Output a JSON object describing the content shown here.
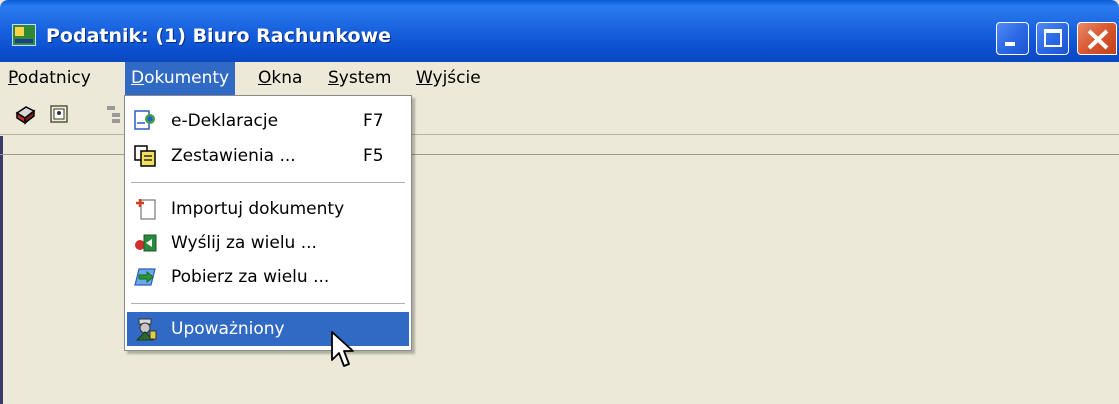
{
  "window": {
    "title": "Podatnik: (1) Biuro Rachunkowe",
    "icon": "app-icon"
  },
  "menubar": {
    "items": [
      {
        "label": "Podatnicy",
        "underline": "P",
        "rest": "odatnicy"
      },
      {
        "label": "Dokumenty",
        "underline": "D",
        "rest": "okumenty",
        "active": true
      },
      {
        "label": "Okna",
        "underline": "O",
        "rest": "kna"
      },
      {
        "label": "System",
        "underline": "S",
        "rest": "ystem"
      },
      {
        "label": "Wyjście",
        "underline": "W",
        "rest": "yjście"
      }
    ]
  },
  "toolbar": {
    "icons": [
      "printer-icon",
      "card-icon",
      "tree-icon"
    ]
  },
  "dropdown": {
    "items": [
      {
        "label": "e-Deklaracje",
        "shortcut": "F7",
        "icon": "e-declaration-icon"
      },
      {
        "label": "Zestawienia ...",
        "shortcut": "F5",
        "icon": "documents-stack-icon"
      },
      {
        "label": "Importuj dokumenty",
        "shortcut": "",
        "icon": "import-document-icon"
      },
      {
        "label": "Wyślij za wielu ...",
        "shortcut": "",
        "icon": "send-many-icon"
      },
      {
        "label": "Pobierz za wielu ...",
        "shortcut": "",
        "icon": "download-many-icon"
      },
      {
        "label": "Upoważniony",
        "shortcut": "",
        "icon": "authorized-person-icon",
        "highlighted": true
      }
    ]
  },
  "colors": {
    "titlebar": "#0a4fcf",
    "highlight": "#316ac5",
    "face": "#ece9d8"
  }
}
